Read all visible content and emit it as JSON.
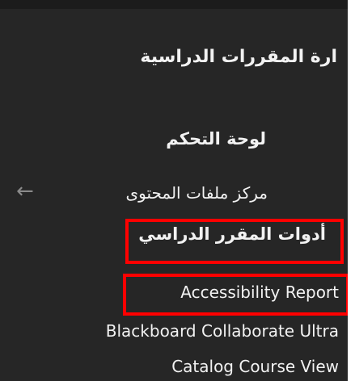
{
  "section": {
    "title": "ارة المقررات الدراسية"
  },
  "menu": {
    "items": [
      {
        "label": "لوحة التحكم"
      },
      {
        "label": "مركز ملفات المحتوى"
      },
      {
        "label": "أدوات المقرر الدراسي"
      },
      {
        "label": "Accessibility Report"
      },
      {
        "label": "Blackboard Collaborate Ultra"
      },
      {
        "label": "Catalog Course View"
      }
    ],
    "back_arrow": "←"
  },
  "colors": {
    "panel_background": "#262626",
    "text": "#f2f2f2",
    "highlight": "#ff0000",
    "arrow": "#8a8a8a"
  }
}
